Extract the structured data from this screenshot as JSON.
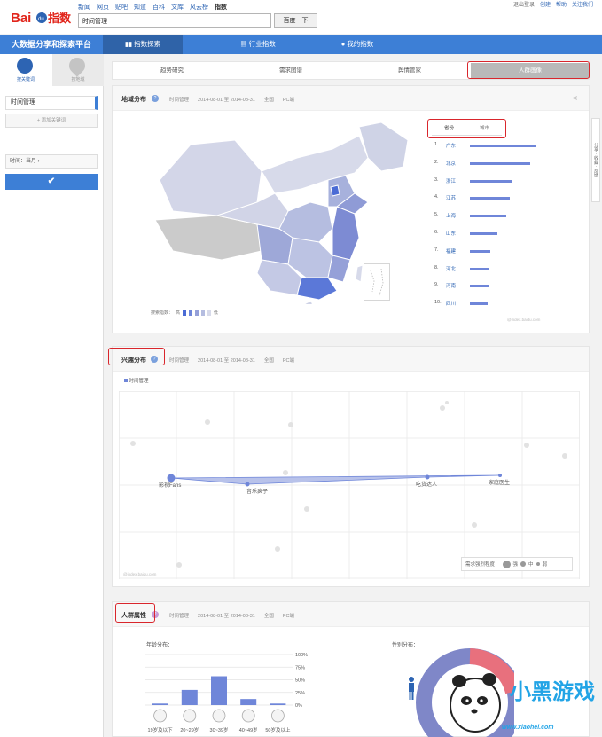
{
  "header": {
    "logo_text": "Bai du 指数",
    "nav_links": [
      "新闻",
      "网页",
      "贴吧",
      "知道",
      "百科",
      "文库",
      "风云榜",
      "指数"
    ],
    "search_value": "时间管理",
    "search_button": "百度一下",
    "user_links": [
      "退出登录",
      "创建",
      "帮助",
      "关注我们"
    ]
  },
  "blue_nav": {
    "brand": "大数据分享和探索平台",
    "tabs": [
      "指数探索",
      "行业指数",
      "我的指数"
    ],
    "tab_icons": [
      "chart-icon",
      "building-icon",
      "person-icon"
    ]
  },
  "sidebar": {
    "tabs": [
      "按关键词",
      "按地域"
    ],
    "keyword": "时间管理",
    "add_keyword": "+ 添加关键词",
    "time_label": "时间：当月 ›",
    "confirm_icon": "checkmark-icon"
  },
  "subtabs": [
    "趋势研究",
    "需求图谱",
    "舆情管家",
    "人群画像"
  ],
  "meta": {
    "keyword": "时间管理",
    "date_range": "2014-08-01 至 2014-08-31",
    "area": "全国",
    "device": "PC端"
  },
  "region_panel": {
    "title": "地域分布",
    "tabs": [
      "省份",
      "城市"
    ],
    "ranking": [
      {
        "rank": "1.",
        "name": "广东",
        "value": 1.0
      },
      {
        "rank": "2.",
        "name": "北京",
        "value": 0.9
      },
      {
        "rank": "3.",
        "name": "浙江",
        "value": 0.62
      },
      {
        "rank": "4.",
        "name": "江苏",
        "value": 0.6
      },
      {
        "rank": "5.",
        "name": "上海",
        "value": 0.54
      },
      {
        "rank": "6.",
        "name": "山东",
        "value": 0.41
      },
      {
        "rank": "7.",
        "name": "福建",
        "value": 0.3
      },
      {
        "rank": "8.",
        "name": "河北",
        "value": 0.29
      },
      {
        "rank": "9.",
        "name": "河南",
        "value": 0.28
      },
      {
        "rank": "10.",
        "name": "四川",
        "value": 0.27
      }
    ],
    "legend_label": "搜索指数：",
    "legend_high": "高",
    "legend_low": "低",
    "watermark": "@index.baidu.com"
  },
  "interest_panel": {
    "title": "兴趣分布",
    "legend": "时间管理",
    "nodes": [
      "影视Fans",
      "音乐疯子",
      "吃货达人",
      "家庭医生"
    ],
    "strength_label": "需求强烈程度：",
    "strength_levels": [
      "强",
      "中",
      "弱"
    ],
    "watermark": "@index.baidu.com"
  },
  "crowd_panel": {
    "title": "人群属性",
    "age_title": "年龄分布：",
    "gender_title": "性别分布：",
    "age_axis": [
      "100%",
      "75%",
      "50%",
      "25%",
      "0%"
    ],
    "age_groups": [
      "19岁及以下",
      "20~29岁",
      "30~39岁",
      "40~49岁",
      "50岁及以上"
    ],
    "age_values": [
      3,
      30,
      57,
      12,
      3
    ]
  },
  "side_float": [
    "分享",
    "收藏",
    "反馈"
  ],
  "site_watermark": "www.xiaohei.com",
  "site_watermark_logo": "小黑游戏",
  "colors": {
    "accent": "#3d7fd6",
    "bar": "#6f86d9",
    "highlight": "#d9262c"
  }
}
